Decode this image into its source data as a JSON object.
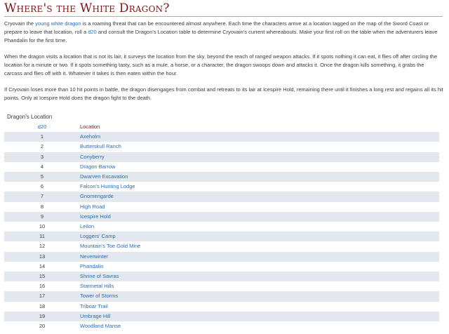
{
  "heading": "Where's the White Dragon?",
  "paragraph1": {
    "t1": "Cryovain the ",
    "link1": "young white dragon",
    "t2": " is a roaming threat that can be encountered almost anywhere. Each time the characters arrive at a location tagged on the map of the Sword Coast or prepare to leave that location, roll a ",
    "link2": "d20",
    "t3": " and consult the Dragon's Location table to determine Cryovain's current whereabouts. Make your first roll on the table when the adventurers leave Phandalin for the first time."
  },
  "paragraph2": "When the dragon visits a location that is not its lair, it surveys the location from the sky, beyond the reach of ranged weapon attacks. If it spots nothing it can eat, it flies off after circling the location for a minute or two. If it spots something tasty, such as a mule, a horse, or a character, the dragon swoops down and attacks it. Once the dragon kills something, it grabs the carcass and flies off with it. Whatever it takes is then eaten within the hour.",
  "paragraph3": "If Cryovain loses more than 10 hit points in battle, the dragon disengages from combat and retreats to its lair at Icespire Hold, remaining there until it finishes a long rest and regains all its hit points. Only at Icespire Hold does the dragon fight to the death.",
  "table": {
    "caption": "Dragon's Location",
    "headers": {
      "die": "d20",
      "location": "Location"
    },
    "rows": [
      {
        "roll": "1",
        "location": "Axeholm"
      },
      {
        "roll": "2",
        "location": "Butterskull Ranch"
      },
      {
        "roll": "3",
        "location": "Conyberry"
      },
      {
        "roll": "4",
        "location": "Dragon Barrow"
      },
      {
        "roll": "5",
        "location": "Dwarven Excavation"
      },
      {
        "roll": "6",
        "location": "Falcon's Hunting Lodge"
      },
      {
        "roll": "7",
        "location": "Gnomengarde"
      },
      {
        "roll": "8",
        "location": "High Road"
      },
      {
        "roll": "9",
        "location": "Icespire Hold"
      },
      {
        "roll": "10",
        "location": "Leilon"
      },
      {
        "roll": "11",
        "location": "Loggers' Camp"
      },
      {
        "roll": "12",
        "location": "Mountain's Toe Gold Mine"
      },
      {
        "roll": "13",
        "location": "Neverwinter"
      },
      {
        "roll": "14",
        "location": "Phandalin"
      },
      {
        "roll": "15",
        "location": "Shrine of Savras"
      },
      {
        "roll": "16",
        "location": "Starmetal Hills"
      },
      {
        "roll": "17",
        "location": "Tower of Storms"
      },
      {
        "roll": "18",
        "location": "Triboar Trail"
      },
      {
        "roll": "19",
        "location": "Umbrage Hill"
      },
      {
        "roll": "20",
        "location": "Woodland Manse"
      }
    ]
  },
  "colors": {
    "heading": "#7b1418",
    "link": "#2a6db1",
    "rule": "#c9ad6a",
    "stripe": "#e2e8ee",
    "text": "#3a3a3a"
  }
}
